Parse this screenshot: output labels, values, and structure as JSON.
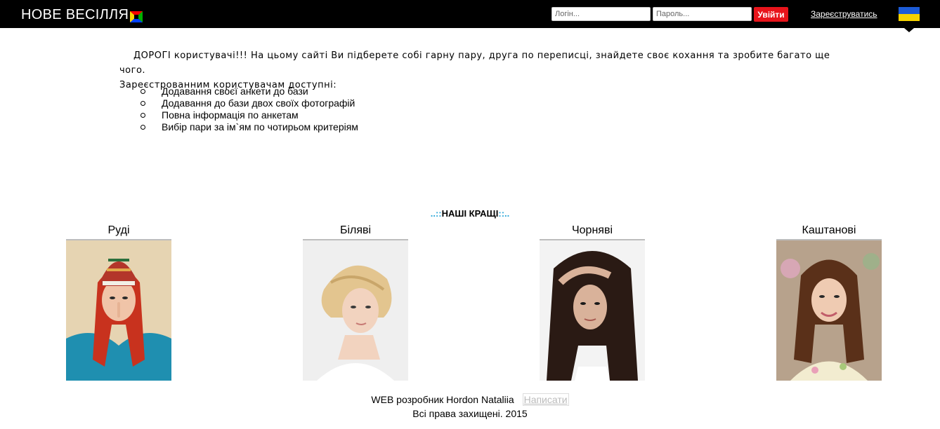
{
  "header": {
    "brand": "НОВЕ ВЕСІЛЛЯ",
    "login_placeholder": "Логін...",
    "password_placeholder": "Пароль...",
    "login_button": "Увійти",
    "register_link": "Зареєструватись",
    "flag_colors": [
      "#1c5bd6",
      "#f5d200"
    ]
  },
  "intro": {
    "lead": "ДОРОГІ користувачі!!! На цьому сайті Ви підберете собі гарну пару, друга по переписці, знайдете своє кохання та зробите багато ще чого.",
    "subtitle": "Зареєстрованним користувачам доступні:",
    "features": [
      "Додавання своєї анкети до бази",
      "Додавання до бази двох своїх фотографій",
      "Повна інформація по анкетам",
      "Вибір пари за ім`ям по чотирьом критеріям"
    ]
  },
  "best": {
    "dots_left": "..::",
    "title": "НАШІ КРАЩІ",
    "dots_right": "::..",
    "categories": [
      {
        "label": "Руді",
        "hair": "#c8321e",
        "bg": "#e9d6b4"
      },
      {
        "label": "Біляві",
        "hair": "#e3c58f",
        "bg": "#eeeeee"
      },
      {
        "label": "Чорняві",
        "hair": "#2a1a14",
        "bg": "#f3f3f3"
      },
      {
        "label": "Каштанові",
        "hair": "#5a3019",
        "bg": "#b7a28c"
      }
    ]
  },
  "footer": {
    "developer": "WEB розробник Hordon Nataliia",
    "write_link": "Написати",
    "copyright": "Всі права захищені. 2015"
  },
  "colors": {
    "accent_red": "#e8141b",
    "dots_blue": "#29a6d8"
  }
}
